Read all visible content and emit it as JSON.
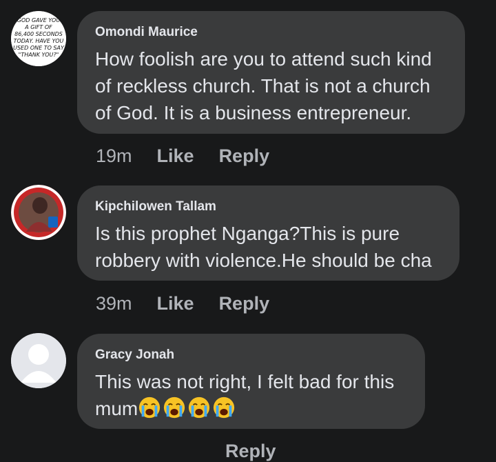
{
  "comments": [
    {
      "author": "Omondi Maurice",
      "text": "How foolish are you to attend such kind\nof reckless church. That is not a church\nof God. It is a business entrepreneur.",
      "time": "19m",
      "like": "Like",
      "reply": "Reply",
      "avatar_text": [
        "GOD GAVE YOU",
        "A GIFT OF",
        "86,400 SECONDS",
        "TODAY. HAVE YOU",
        "USED ONE TO SAY",
        "\"THANK YOU?\""
      ]
    },
    {
      "author": "Kipchilowen Tallam",
      "text": "Is this prophet Nganga?This is pure\nrobbery with violence.He should be cha",
      "time": "39m",
      "like": "Like",
      "reply": "Reply"
    },
    {
      "author": "Gracy Jonah",
      "text": "This was not right, I felt bad for this\nmum",
      "reply": "Reply",
      "emoji": [
        "loudly-crying-face",
        "loudly-crying-face",
        "loudly-crying-face",
        "loudly-crying-face"
      ]
    }
  ],
  "colors": {
    "background": "#18191a",
    "bubble": "#3a3b3c",
    "text": "#e4e6eb",
    "secondary": "#b0b3b8"
  }
}
